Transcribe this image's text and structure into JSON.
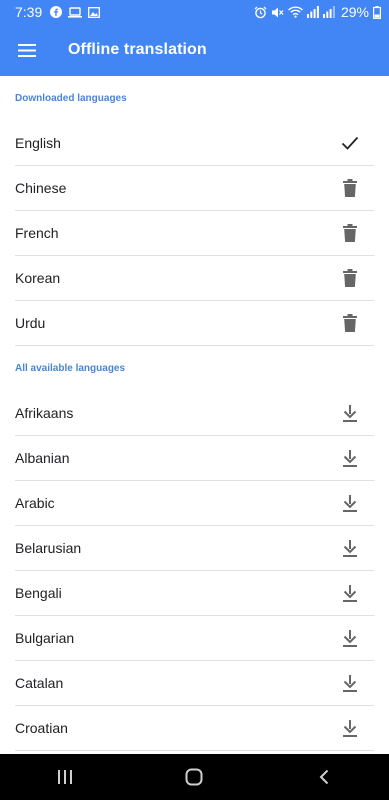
{
  "status_bar": {
    "time": "7:39",
    "battery": "29%",
    "left_icons": [
      "facebook-icon",
      "laptop-icon",
      "image-icon"
    ],
    "right_icons": [
      "alarm-icon",
      "mute-icon",
      "wifi-icon",
      "signal-icon",
      "signal-icon",
      "battery-icon"
    ]
  },
  "app_bar": {
    "title": "Offline translation",
    "background": "#4285f4"
  },
  "downloaded": {
    "header": "Downloaded languages",
    "items": [
      {
        "label": "English",
        "icon": "check-icon"
      },
      {
        "label": "Chinese",
        "icon": "trash-icon"
      },
      {
        "label": "French",
        "icon": "trash-icon"
      },
      {
        "label": "Korean",
        "icon": "trash-icon"
      },
      {
        "label": "Urdu",
        "icon": "trash-icon"
      }
    ]
  },
  "available": {
    "header": "All available languages",
    "items": [
      {
        "label": "Afrikaans",
        "icon": "download-icon"
      },
      {
        "label": "Albanian",
        "icon": "download-icon"
      },
      {
        "label": "Arabic",
        "icon": "download-icon"
      },
      {
        "label": "Belarusian",
        "icon": "download-icon"
      },
      {
        "label": "Bengali",
        "icon": "download-icon"
      },
      {
        "label": "Bulgarian",
        "icon": "download-icon"
      },
      {
        "label": "Catalan",
        "icon": "download-icon"
      },
      {
        "label": "Croatian",
        "icon": "download-icon"
      }
    ]
  },
  "colors": {
    "accent": "#4285f4",
    "section_header": "#4a86cf",
    "icon_gray": "#666666"
  },
  "nav_bar": {
    "buttons": [
      "recents-icon",
      "home-icon",
      "back-icon"
    ]
  }
}
